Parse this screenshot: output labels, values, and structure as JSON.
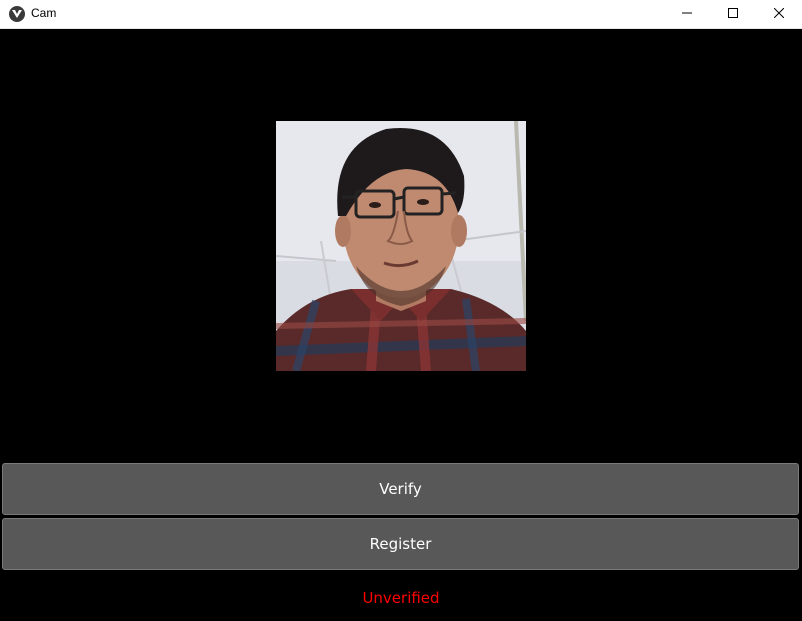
{
  "window": {
    "title": "Cam",
    "icon": "kivy-app-icon",
    "controls": {
      "minimize_icon": "minimize-icon",
      "maximize_icon": "maximize-icon",
      "close_icon": "close-icon"
    }
  },
  "webcam": {
    "feed_description": "live-camera-frame"
  },
  "buttons": {
    "verify_label": "Verify",
    "register_label": "Register"
  },
  "status": {
    "text": "Unverified",
    "color": "#ff0000"
  },
  "colors": {
    "background": "#000000",
    "button_bg": "#585858",
    "button_text": "#ffffff"
  }
}
